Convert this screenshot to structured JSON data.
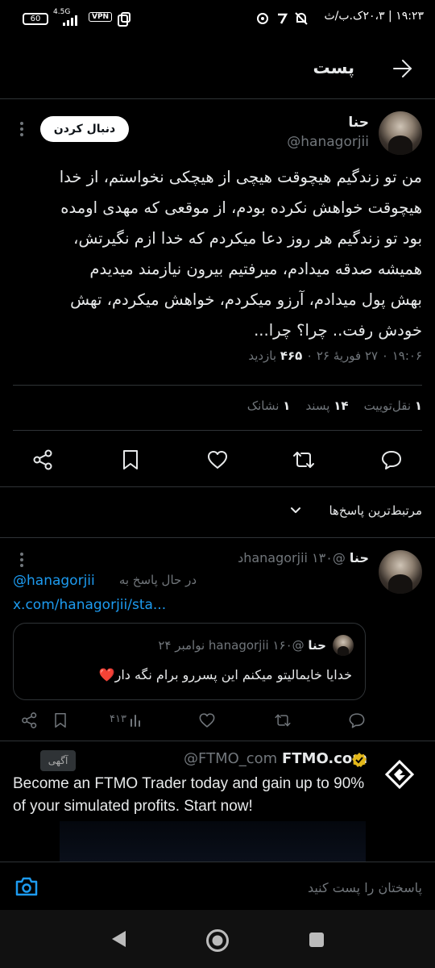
{
  "status_bar": {
    "time": "۱۹:۲۳ | ۲۰،۳ک.ب/ث",
    "battery": "60",
    "network": "4.5G",
    "vpn": "VPN"
  },
  "header": {
    "title": "پست",
    "back_icon": "arrow-right-icon"
  },
  "post": {
    "author_name": "حنا",
    "author_handle": "@hanagorjii",
    "follow_label": "دنبال کردن",
    "body": "من تو زندگیم هیچوقت هیچی از هیچکی نخواستم، از خدا\nهیچوقت خواهش نکرده بودم، از موقعی که مهدی اومده\nبود تو زندگیم هر روز دعا میکردم که خدا ازم نگیرتش،\nهمیشه صدقه میدادم، میرفتیم بیرون نیازمند میدیدم\nبهش پول میدادم، آرزو میکردم، خواهش میکردم، تهش\nخودش رفت.. چرا؟ چرا...",
    "meta_time": "۱۹:۰۶ ۰ ۲۷ فوریهٔ ۲۶ ۰",
    "meta_views_count": "۴۶۵",
    "meta_views_label": "بازدید",
    "stats": {
      "retweets_count": "۱",
      "retweets_label": "نقل‌توییت",
      "likes_count": "۱۴",
      "likes_label": "پسند",
      "bookmarks_count": "۱",
      "bookmarks_label": "نشانک"
    }
  },
  "replies_sort": {
    "label": "مرتبط‌ترین پاسخ‌ها"
  },
  "reply": {
    "author_name": "حنا",
    "author_handle": "@hanagorjii",
    "time": "۱۳۰د",
    "replying_to_label": "در حال پاسخ به",
    "replying_to_handle": "@hanagorjii",
    "link_text": "x.com/hanagorjii/sta...",
    "quote": {
      "author_name": "حنا",
      "author_handle": "@hanagorjii",
      "date": "۱۶۰ نوامبر ۲۴",
      "text": "خدایا خایمالیتو میکنم این پسررو برام نگه دار",
      "emoji": "❤️"
    },
    "views": "۴۱۳"
  },
  "ad": {
    "name": "FTMO.com",
    "handle": "@FTMO_com",
    "tag": "آگهی",
    "text": "Become an FTMO Trader today and gain up to 90% of your simulated profits. Start now!"
  },
  "compose": {
    "placeholder": "پاسختان را پست کنید"
  },
  "colors": {
    "background": "#000000",
    "accent": "#1d9bf0",
    "muted": "#71767b",
    "border": "#2f3336",
    "verified": "#e2b719"
  }
}
